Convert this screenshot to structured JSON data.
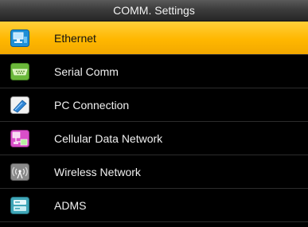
{
  "header": {
    "title": "COMM. Settings"
  },
  "menu": {
    "selected_index": 0,
    "items": [
      {
        "label": "Ethernet",
        "icon": "ethernet-icon"
      },
      {
        "label": "Serial Comm",
        "icon": "serial-port-icon"
      },
      {
        "label": "PC Connection",
        "icon": "pc-connection-icon"
      },
      {
        "label": "Cellular Data Network",
        "icon": "cellular-network-icon"
      },
      {
        "label": "Wireless Network",
        "icon": "wireless-antenna-icon"
      },
      {
        "label": "ADMS",
        "icon": "adms-server-icon"
      }
    ]
  },
  "colors": {
    "selected_background": "#ffb700",
    "background": "#000000",
    "text": "#f0f0f0"
  }
}
